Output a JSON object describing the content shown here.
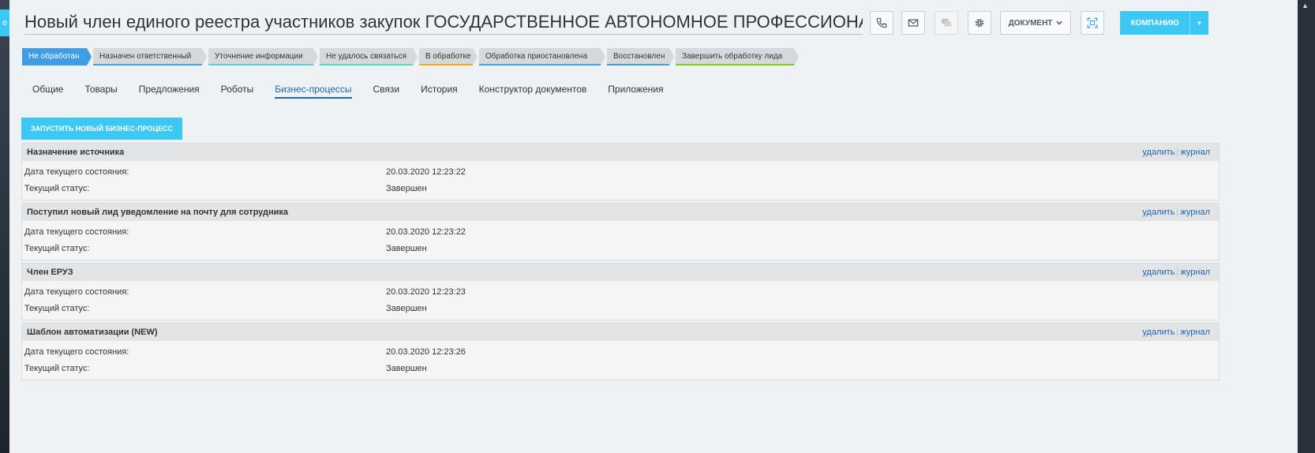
{
  "left_tab": "е",
  "header": {
    "title": "Новый член единого реестра участников закупок ГОСУДАРСТВЕННОЕ АВТОНОМНОЕ ПРОФЕССИОНАЛЬНОЕ ОБРАЗОВАТЕЛЬНОЕ",
    "document_label": "ДОКУМЕНТ",
    "company_label": "КОМПАНИЮ"
  },
  "stages": [
    {
      "label": "Не обработан",
      "color": "#3e9de5",
      "active": true
    },
    {
      "label": "Назначен ответственный",
      "color": "#39a8ef"
    },
    {
      "label": "Уточнение информации",
      "color": "#55d0e0"
    },
    {
      "label": "Не удалось связаться",
      "color": "#47e4c2"
    },
    {
      "label": "В обработке",
      "color": "#ffa900"
    },
    {
      "label": "Обработка приостановлена",
      "color": "#39a8ef"
    },
    {
      "label": "Восстановлен",
      "color": "#3e9de5"
    },
    {
      "label": "Завершить обработку лида",
      "color": "#7bd500"
    }
  ],
  "tabs": {
    "general": "Общие",
    "products": "Товары",
    "offers": "Предложения",
    "robots": "Роботы",
    "bp": "Бизнес-процессы",
    "links": "Связи",
    "history": "История",
    "doc_builder": "Конструктор документов",
    "apps": "Приложения"
  },
  "start_bp_label": "ЗАПУСТИТЬ НОВЫЙ БИЗНЕС-ПРОЦЕСС",
  "process_labels": {
    "date": "Дата текущего состояния:",
    "status": "Текущий статус:",
    "delete": "удалить",
    "log": "журнал"
  },
  "processes": [
    {
      "name": "Назначение источника",
      "date": "20.03.2020 12:23:22",
      "status": "Завершен"
    },
    {
      "name": "Поступил новый лид уведомление на почту для сотрудника",
      "date": "20.03.2020 12:23:22",
      "status": "Завершен"
    },
    {
      "name": "Член ЕРУЗ",
      "date": "20.03.2020 12:23:23",
      "status": "Завершен"
    },
    {
      "name": "Шаблон автоматизации (NEW)",
      "date": "20.03.2020 12:23:26",
      "status": "Завершен"
    }
  ]
}
